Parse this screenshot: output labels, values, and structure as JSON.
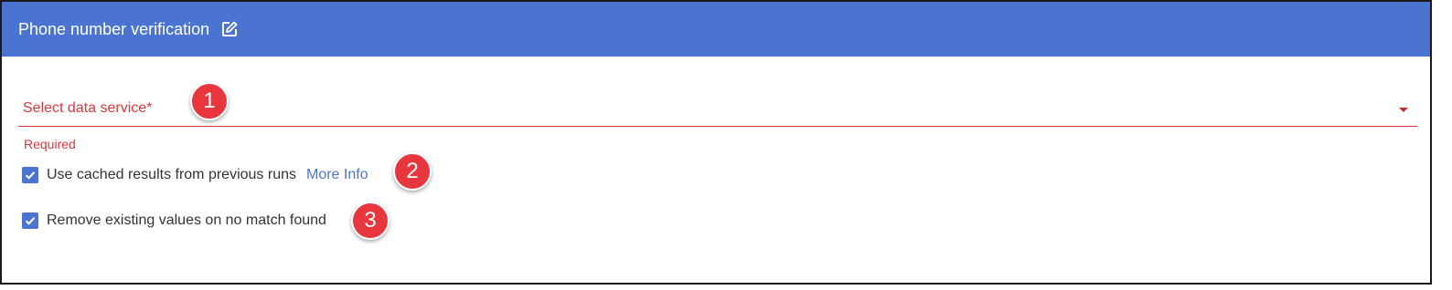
{
  "header": {
    "title": "Phone number verification",
    "edit_icon": "edit-icon"
  },
  "form": {
    "data_service": {
      "label": "Select data service*",
      "error": "Required"
    },
    "cached_results": {
      "label": "Use cached results from previous runs",
      "checked": true,
      "link": "More Info"
    },
    "remove_existing": {
      "label": "Remove existing values on no match found",
      "checked": true
    }
  },
  "badges": [
    "1",
    "2",
    "3"
  ],
  "colors": {
    "header_bg": "#4a74d0",
    "accent": "#4a74d0",
    "error": "#d9363e",
    "badge": "#e8363e"
  }
}
